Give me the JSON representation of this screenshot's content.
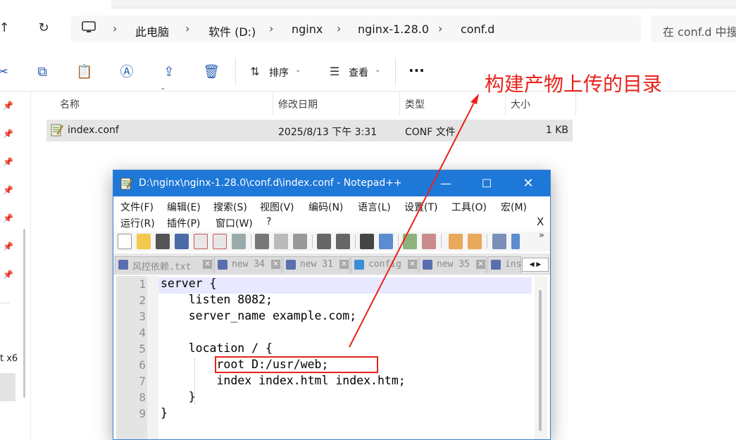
{
  "address_bar": {
    "breadcrumbs": [
      "此电脑",
      "软件 (D:)",
      "nginx",
      "nginx-1.28.0",
      "conf.d"
    ],
    "search_placeholder": "在 conf.d 中搜"
  },
  "toolbar": {
    "sort_label": "排序",
    "view_label": "查看",
    "more_label": "···"
  },
  "columns": {
    "name": "名称",
    "modified": "修改日期",
    "type": "类型",
    "size": "大小"
  },
  "files": [
    {
      "name": "index.conf",
      "modified": "2025/8/13 下午 3:31",
      "type": "CONF 文件",
      "size": "1 KB"
    }
  ],
  "sidebar": {
    "partial_text": "t x6"
  },
  "annotation": {
    "text": "构建产物上传的目录",
    "color": "#e8231b"
  },
  "notepad": {
    "title": "D:\\nginx\\nginx-1.28.0\\conf.d\\index.conf - Notepad++",
    "menu_row1": [
      "文件(F)",
      "编辑(E)",
      "搜索(S)",
      "视图(V)",
      "编码(N)",
      "语言(L)",
      "设置(T)",
      "工具(O)",
      "宏(M)"
    ],
    "menu_row2": [
      "运行(R)",
      "插件(P)",
      "窗口(W)",
      "?"
    ],
    "menu_close": "X",
    "tabs": [
      "风控依赖.txt",
      "new 34",
      "new 31",
      "config",
      "new 35",
      "ins"
    ],
    "line_numbers": [
      "1",
      "2",
      "3",
      "4",
      "5",
      "6",
      "7",
      "8",
      "9"
    ],
    "code_lines": [
      "server {",
      "    listen 8082;",
      "    server_name example.com;",
      "",
      "    location / {",
      "        root D:/usr/web;",
      "        index index.html index.htm;",
      "    }",
      "}"
    ]
  },
  "colors": {
    "accent": "#1e78d7",
    "annotation": "#e8231b",
    "selection": "#e5e5e5"
  }
}
